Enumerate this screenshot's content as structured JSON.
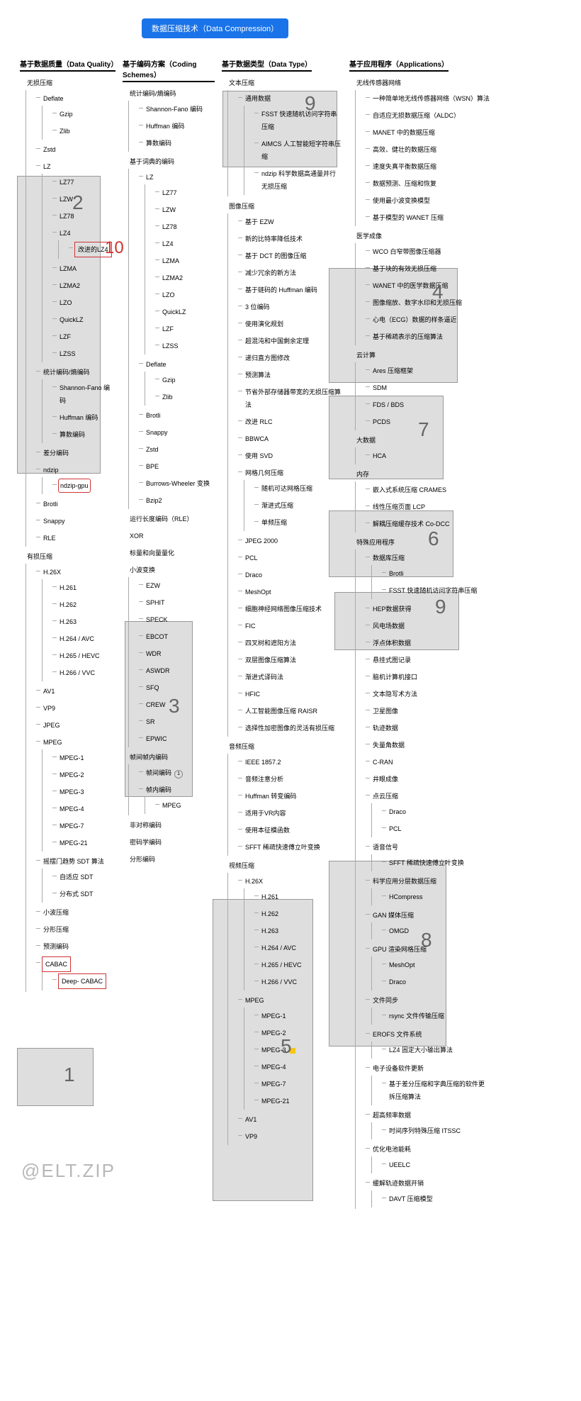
{
  "root": "数据压缩技术（Data Compression）",
  "watermark": "@ELT.ZIP",
  "red_number": "10",
  "categories": {
    "quality": {
      "title": "基于数据质量（Data Quality）",
      "lossless": {
        "label": "无损压缩",
        "items": [
          "Deflate",
          "Gzip",
          "Zlib",
          "Zstd"
        ],
        "lz": {
          "label": "LZ",
          "items": [
            "LZ77",
            "LZW",
            "LZ78",
            "LZ4"
          ],
          "lz4mod": "改进的LZ4",
          "items2": [
            "LZMA",
            "LZMA2",
            "LZO",
            "QuickLZ",
            "LZF",
            "LZSS"
          ]
        },
        "stat": {
          "label": "统计编码/熵编码",
          "items": [
            "Shannon-Fano 编码",
            "Huffman 编码",
            "算数编码"
          ]
        },
        "misc": [
          "差分编码"
        ],
        "ndzip": {
          "label": "ndzip",
          "gpu": "ndzip-gpu"
        },
        "tail": [
          "Brotli",
          "Snappy",
          "RLE"
        ]
      },
      "lossy": {
        "label": "有损压缩",
        "h26x": {
          "label": "H.26X",
          "items": [
            "H.261",
            "H.262",
            "H.263",
            "H.264 / AVC",
            "H.265 / HEVC",
            "H.266 / VVC"
          ]
        },
        "codecs": [
          "AV1",
          "VP9",
          "JPEG"
        ],
        "mpeg": {
          "label": "MPEG",
          "items": [
            "MPEG-1",
            "MPEG-2",
            "MPEG-3",
            "MPEG-4",
            "MPEG-7",
            "MPEG-21"
          ]
        },
        "sdt": {
          "label": "摇摆门趋势 SDT 算法",
          "items": [
            "自适应 SDT",
            "分布式 SDT"
          ]
        },
        "bottom": [
          "小波压缩",
          "分形压缩",
          "预测编码"
        ],
        "cabac": {
          "label": "CABAC",
          "deep": "Deep- CABAC"
        }
      }
    },
    "coding": {
      "title": "基于编码方案（Coding Schemes）",
      "stat": {
        "label": "统计编码/熵编码",
        "items": [
          "Shannon-Fano 编码",
          "Huffman 编码",
          "算数编码"
        ]
      },
      "dict": {
        "label": "基于词典的编码",
        "lz": {
          "label": "LZ",
          "items": [
            "LZ77",
            "LZW",
            "LZ78",
            "LZ4",
            "LZMA",
            "LZMA2",
            "LZO",
            "QuickLZ",
            "LZF",
            "LZSS"
          ]
        },
        "defl": {
          "label": "Deflate",
          "items": [
            "Gzip",
            "Zlib"
          ]
        },
        "rest": [
          "Brotli",
          "Snappy",
          "Zstd",
          "BPE",
          "Burrows-Wheeler 变换",
          "Bzip2"
        ]
      },
      "rle": "运行长度编码（RLE）",
      "xor": "XOR",
      "quant": "标量和向量量化",
      "wavelet": {
        "label": "小波变换",
        "items": [
          "EZW",
          "SPHIT",
          "SPECK",
          "EBCOT",
          "WDR",
          "ASWDR",
          "SFQ",
          "CREW",
          "SR",
          "EPWIC"
        ]
      },
      "frame": {
        "label": "帧间帧内编码",
        "intra": {
          "label": "帧间编码",
          "badge": "1"
        },
        "items": [
          "帧内编码",
          "MPEG"
        ]
      },
      "tail": [
        "非对称编码",
        "密码学编码",
        "分形编码"
      ]
    },
    "datatype": {
      "title": "基于数据类型（Data Type）",
      "text": {
        "label": "文本压缩",
        "generic": {
          "label": "通用数据",
          "items": [
            "FSST 快速随机访问字符串压缩",
            "AIMCS 人工智能短字符串压缩",
            "ndzip 科学数据高通量并行无损压缩"
          ]
        }
      },
      "image": {
        "label": "图像压缩",
        "items": [
          "基于 EZW",
          "新的比特率降低技术",
          "基于 DCT 的图像压缩",
          "减少冗余的新方法",
          "基于链码的 Huffman 编码",
          "3 位编码",
          "使用演化规划",
          "超混沌和中国剩余定理",
          "递归直方图修改",
          "预测算法",
          "节省外部存储器带宽的无损压缩算法",
          "改进 RLC",
          "BBWCA",
          "使用 SVD"
        ],
        "mesh": {
          "label": "网格几何压缩",
          "items": [
            "随机可达网格压缩",
            "渐进式压缩",
            "单频压缩"
          ]
        },
        "tail": [
          "JPEG 2000",
          "PCL",
          "Draco",
          "MeshOpt",
          "细胞神经网络图像压缩技术",
          "FIC",
          "四叉树和遮阳方法",
          "双层图像压缩算法",
          "渐进式译码法",
          "HFIC",
          "人工智能图像压缩 RAISR",
          "选择性加密图像的灵活有损压缩"
        ]
      },
      "audio": {
        "label": "音频压缩",
        "items": [
          "IEEE 1857.2",
          "音频注意分析",
          "Huffman 转变编码",
          "适用于VR内容",
          "使用本征模函数",
          "SFFT 稀疏快速傅立叶变换"
        ]
      },
      "video": {
        "label": "视频压缩",
        "h26x": {
          "label": "H.26X",
          "items": [
            "H.261",
            "H.262",
            "H.263",
            "H.264 / AVC",
            "H.265 / HEVC",
            "H.266 / VVC"
          ]
        },
        "mpeg": {
          "label": "MPEG",
          "items": [
            "MPEG-1",
            "MPEG-2",
            "MPEG-3",
            "MPEG-4",
            "MPEG-7",
            "MPEG-21"
          ]
        },
        "tail": [
          "AV1",
          "VP9"
        ]
      }
    },
    "apps": {
      "title": "基于应用程序（Applications）",
      "wsn": {
        "label": "无线传感器网络",
        "items": [
          "一种简单地无线传感器网络（WSN）算法",
          "自适应无损数据压缩（ALDC）",
          "MANET 中的数据压缩",
          "高效、健壮的数据压缩",
          "速度失真平衡数据压缩",
          "数据预测、压缩和恢复",
          "使用最小波变换模型",
          "基于模型的 WANET 压缩"
        ]
      },
      "med": {
        "label": "医学成像",
        "items": [
          "WCO 白窄带图像压缩器",
          "基于块的有效无损压缩",
          "WANET 中的医学数据压缩",
          "图像缩放、数字水印和无损压缩",
          "心电（ECG）数据的样条逼近",
          "基于稀疏表示的压缩算法"
        ]
      },
      "cloud": {
        "label": "云计算",
        "items": [
          "Ares 压缩框架",
          "SDM",
          "FDS / BDS",
          "PCDS"
        ]
      },
      "bigdata": {
        "label": "大数据",
        "items": [
          "HCA"
        ]
      },
      "mem": {
        "label": "内存",
        "items": [
          "嵌入式系统压缩 CRAMES",
          "线性压缩页面 LCP",
          "解耦压缩缓存技术 Co-DCC"
        ]
      },
      "special": {
        "label": "特殊应用程序",
        "db": {
          "label": "数据库压缩",
          "items": [
            "Brotli",
            "FSST 快速随机访问字符串压缩"
          ]
        },
        "misc": [
          "HEP数据获得",
          "风电场数据",
          "浮点体积数据",
          "悬挂式图记录",
          "脑机计算机接口",
          "文本隐写术方法",
          "卫星图像",
          "轨迹数据",
          "失量角数据",
          "C-RAN",
          "井眼成像",
          "点云压缩"
        ],
        "pcl": {
          "items": [
            "Draco",
            "PCL"
          ]
        },
        "voice": {
          "label": "语音信号",
          "items": [
            "SFFT 稀疏快速傅立叶变换"
          ]
        },
        "sci": {
          "label": "科学应用分层数据压缩",
          "items": [
            "HCompress"
          ]
        },
        "gan": {
          "label": "GAN 媒体压缩",
          "items": [
            "OMGD"
          ]
        },
        "gpu": {
          "label": "GPU 渲染网格压缩",
          "items": [
            "MeshOpt",
            "Draco"
          ]
        },
        "sync": {
          "label": "文件同步",
          "items": [
            "rsync 文件传输压缩"
          ]
        },
        "erofs": {
          "label": "EROFS 文件系统",
          "items": [
            "LZ4 固定大小输出算法"
          ]
        },
        "firmware": {
          "label": "电子设备软件更新",
          "items": [
            "基于差分压缩和字典压缩的软件更拆压缩算法"
          ]
        },
        "hifreq": {
          "label": "超高频率数据",
          "items": [
            "时间序列特殊压缩 ITSSC"
          ]
        },
        "battery": {
          "label": "优化电池能耗",
          "items": [
            "UEELC"
          ]
        },
        "track": {
          "label": "缓解轨迹数据开销",
          "items": [
            "DAVT 压缩模型"
          ]
        }
      }
    }
  },
  "box_numbers": {
    "b1": "1",
    "b2": "2",
    "b3": "3",
    "b4": "4",
    "b5": "5",
    "b6": "6",
    "b7": "7",
    "b8": "8",
    "b9a": "9",
    "b9b": "9"
  }
}
